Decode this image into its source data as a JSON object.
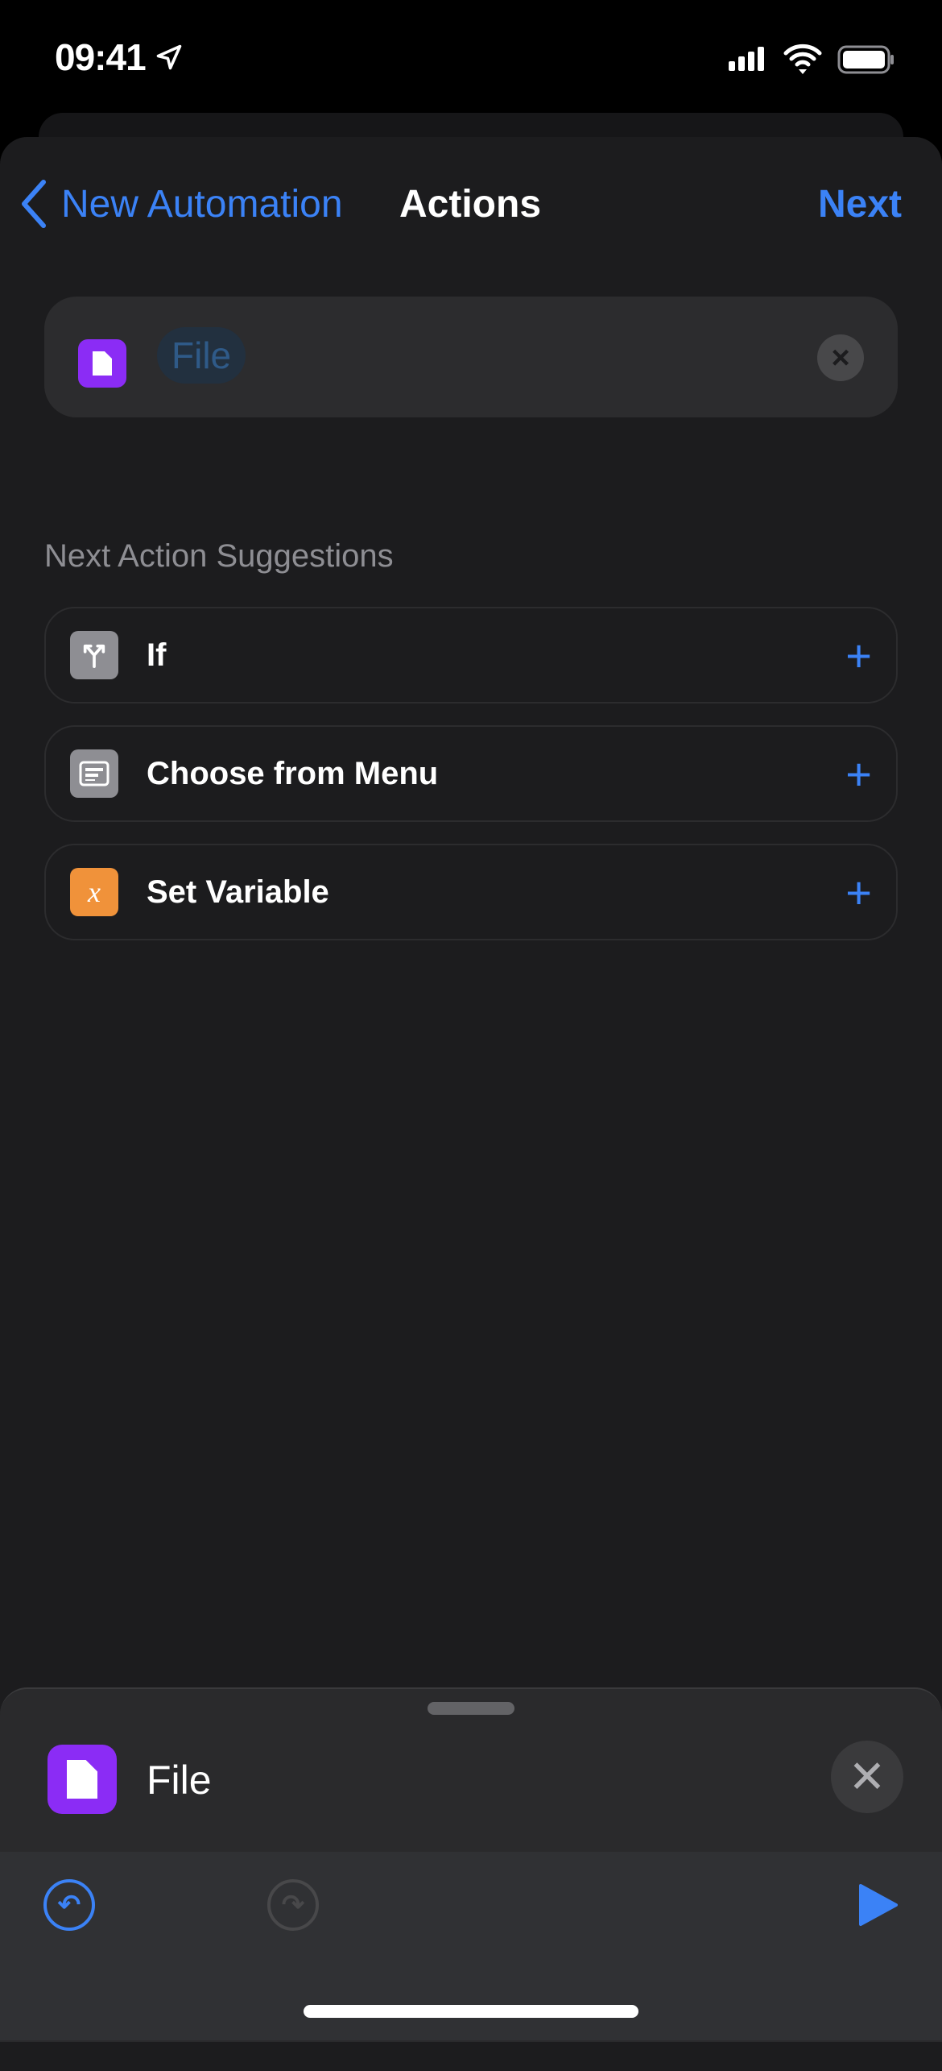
{
  "status_bar": {
    "time": "09:41",
    "location_icon": "location-arrow-icon",
    "signal_icon": "cellular-signal-icon",
    "wifi_icon": "wifi-icon",
    "battery_icon": "battery-icon"
  },
  "nav": {
    "back_label": "New Automation",
    "title": "Actions",
    "next_label": "Next"
  },
  "search": {
    "token": "File",
    "token_icon": "document-icon"
  },
  "suggestions": {
    "header": "Next Action Suggestions",
    "items": [
      {
        "label": "If",
        "icon": "branch-icon",
        "color": "#8e8e93",
        "glyph": "Y"
      },
      {
        "label": "Choose from Menu",
        "icon": "menu-icon",
        "color": "#8e8e93",
        "glyph": "☰"
      },
      {
        "label": "Set Variable",
        "icon": "variable-icon",
        "color": "#f0923a",
        "glyph": "x"
      }
    ]
  },
  "bottom_sheet": {
    "title": "File",
    "close_glyph": "✕"
  },
  "toolbar": {
    "undo_glyph": "↶",
    "redo_glyph": "↷",
    "play_icon": "play-icon"
  },
  "colors": {
    "accent": "#3b82f6",
    "file_purple": "#8b2cf5",
    "background": "#1c1c1e"
  }
}
